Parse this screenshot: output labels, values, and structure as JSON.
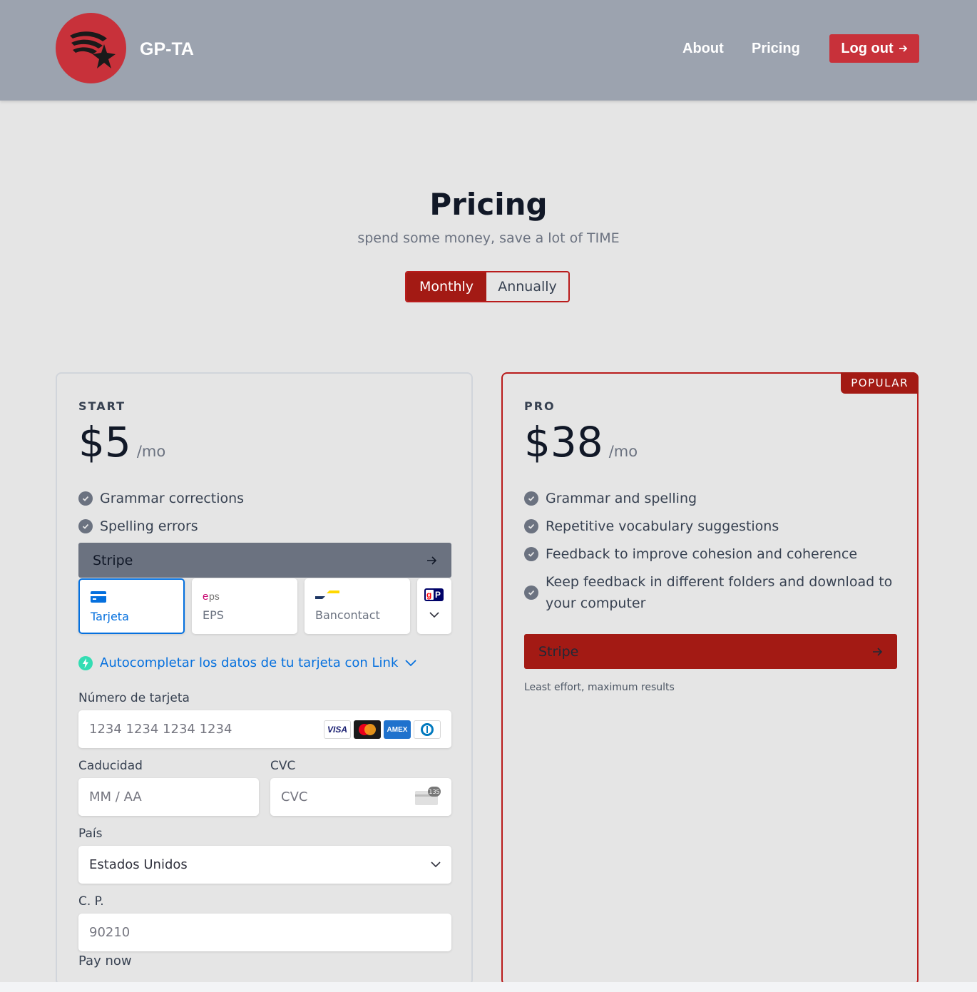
{
  "header": {
    "brand": "GP-TA",
    "nav": {
      "about": "About",
      "pricing": "Pricing"
    },
    "logout_label": "Log out",
    "logout_icon": "arrow-right-icon"
  },
  "hero": {
    "title": "Pricing",
    "subtitle": "spend some money, save a lot of TIME",
    "toggle": {
      "monthly": "Monthly",
      "annually": "Annually",
      "selected": "Monthly"
    }
  },
  "plans": [
    {
      "tier": "START",
      "price": "$5",
      "unit": "/mo",
      "features": [
        "Grammar corrections",
        "Spelling errors"
      ],
      "button_label": "Stripe"
    },
    {
      "tier": "PRO",
      "badge": "POPULAR",
      "price": "$38",
      "unit": "/mo",
      "features": [
        "Grammar and spelling",
        "Repetitive vocabulary suggestions",
        "Feedback to improve cohesion and coherence",
        "Keep feedback in different folders and download to your computer"
      ],
      "button_label": "Stripe",
      "tagline": "Least effort, maximum results"
    }
  ],
  "payment": {
    "methods": [
      {
        "label": "Tarjeta",
        "icon": "card-icon",
        "active": true
      },
      {
        "label": "EPS",
        "icon": "eps-icon",
        "active": false
      },
      {
        "label": "Bancontact",
        "icon": "bancontact-icon",
        "active": false
      }
    ],
    "more_icon": "giropay-icon",
    "link_text": "Autocompletar los datos de tu tarjeta con Link",
    "card_number": {
      "label": "Número de tarjeta",
      "placeholder": "1234 1234 1234 1234"
    },
    "card_brands": [
      "VISA",
      "AMEX"
    ],
    "expiry": {
      "label": "Caducidad",
      "placeholder": "MM / AA"
    },
    "cvc": {
      "label": "CVC",
      "placeholder": "CVC",
      "icon_text": "135"
    },
    "country": {
      "label": "País",
      "value": "Estados Unidos"
    },
    "zip": {
      "label": "C. P.",
      "placeholder": "90210"
    },
    "pay_now": "Pay now"
  },
  "colors": {
    "header_bg": "#9ca3af",
    "accent": "#a31a14",
    "logout_bg": "#c8313a",
    "stripe_start": "#6b7280",
    "link_blue": "#0570de"
  }
}
